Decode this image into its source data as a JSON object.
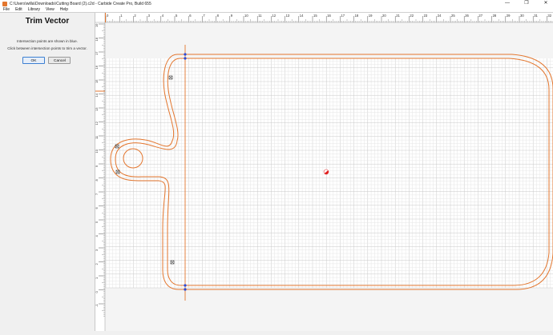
{
  "window": {
    "title": "C:\\Users\\willa\\Downloads\\Cutting Board (2).c2d - Carbide Create Pro, Build 655",
    "minimize_glyph": "—",
    "maximize_glyph": "❐",
    "close_glyph": "✕"
  },
  "menu": [
    "File",
    "Edit",
    "Library",
    "View",
    "Help"
  ],
  "panel": {
    "title": "Trim Vector",
    "instruction_1": "Intersection points are shown in blue.",
    "instruction_2": "Click between intersection points to trim a vector.",
    "ok_label": "OK",
    "cancel_label": "Cancel"
  },
  "ruler": {
    "top_labels": [
      "-1",
      "0",
      "1",
      "2",
      "3",
      "4",
      "5",
      "6",
      "7",
      "8",
      "9",
      "10",
      "11",
      "12",
      "13",
      "14",
      "15",
      "16",
      "17",
      "18",
      "19",
      "20",
      "21",
      "22",
      "23",
      "24",
      "25",
      "26",
      "27",
      "28",
      "29",
      "30",
      "31",
      "32"
    ],
    "left_labels": [
      "19",
      "18",
      "17",
      "16",
      "15",
      "14",
      "13",
      "12",
      "11",
      "10",
      "9",
      "8",
      "7",
      "6",
      "5",
      "4",
      "3",
      "2",
      "1",
      "0",
      "-1"
    ]
  },
  "colors": {
    "accent": "#e3762e",
    "grid_minor": "#e6e6e6",
    "grid_major": "#c9c9c9",
    "ruler_bg": "#ffffff",
    "cursor_red": "#e02020"
  }
}
